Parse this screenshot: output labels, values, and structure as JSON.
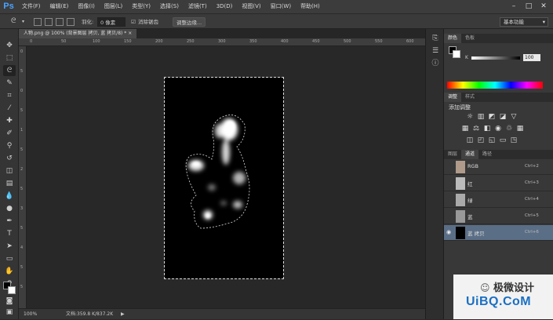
{
  "app": {
    "logo": "Ps"
  },
  "menu": [
    "文件(F)",
    "编辑(E)",
    "图像(I)",
    "图层(L)",
    "类型(Y)",
    "选择(S)",
    "滤镜(T)",
    "3D(D)",
    "视图(V)",
    "窗口(W)",
    "帮助(H)"
  ],
  "window_controls": [
    "–",
    "□",
    "✕"
  ],
  "options": {
    "feather_label": "羽化:",
    "feather_value": "0 像素",
    "antialias_label": "消除锯齿",
    "refine_edge": "调整边缘...",
    "workspace": "基本功能"
  },
  "document": {
    "tab_title": "人物.png @ 100% (背景图层 拷贝, 蓝 拷贝/8) *",
    "close": "×"
  },
  "ruler": {
    "top": [
      "0",
      "50",
      "100",
      "150",
      "200",
      "250",
      "300",
      "350",
      "400",
      "450",
      "500",
      "550",
      "600"
    ],
    "left": [
      "0",
      "5",
      "0",
      "5",
      "1",
      "5",
      "2",
      "5",
      "3",
      "5",
      "4",
      "5",
      "5"
    ]
  },
  "status": {
    "zoom": "100%",
    "doc_size": "文档:359.8 K/837.2K"
  },
  "panels": {
    "color_tabs": [
      "颜色",
      "色板"
    ],
    "k_label": "K",
    "k_value": "100",
    "adjust_tabs": [
      "调整",
      "样式"
    ],
    "adjust_title": "添加调整",
    "layer_tabs": [
      "图层",
      "通道",
      "路径"
    ],
    "channels": [
      {
        "name": "RGB",
        "key": "Ctrl+2"
      },
      {
        "name": "红",
        "key": "Ctrl+3"
      },
      {
        "name": "绿",
        "key": "Ctrl+4"
      },
      {
        "name": "蓝",
        "key": "Ctrl+5"
      },
      {
        "name": "蓝 拷贝",
        "key": "Ctrl+6"
      }
    ]
  },
  "watermark": {
    "text": "极微设计",
    "url": "UiBQ.CoM"
  },
  "colors": {
    "accent": "#4aa3ff",
    "selected_row": "#5a6e86"
  }
}
